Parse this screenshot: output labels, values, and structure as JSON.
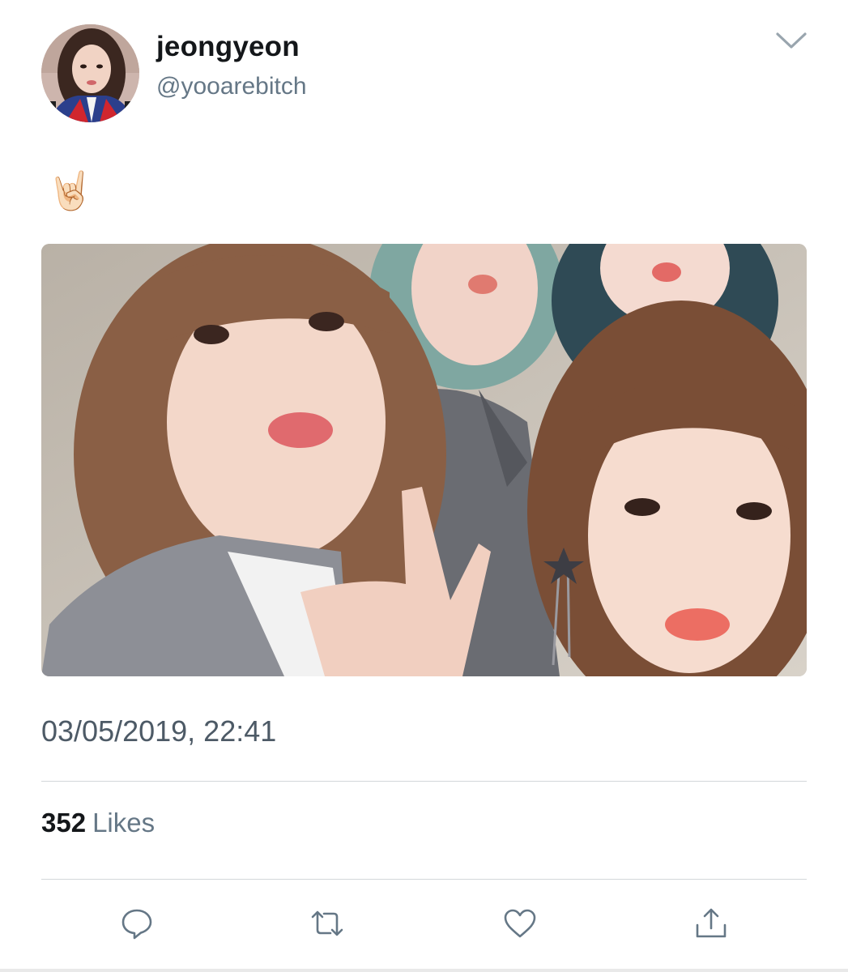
{
  "tweet": {
    "display_name": "jeongyeon",
    "handle": "@yooarebitch",
    "text": "🤘🏻",
    "timestamp": "03/05/2019, 22:41",
    "likes": {
      "count": "352",
      "label": "Likes"
    }
  },
  "icons": {
    "menu": "chevron-down-icon",
    "actions": [
      "reply-icon",
      "retweet-icon",
      "like-icon",
      "share-icon"
    ]
  },
  "colors": {
    "text_primary": "#14171a",
    "text_secondary": "#657786",
    "divider": "#d3d7da",
    "icon": "#657786"
  }
}
